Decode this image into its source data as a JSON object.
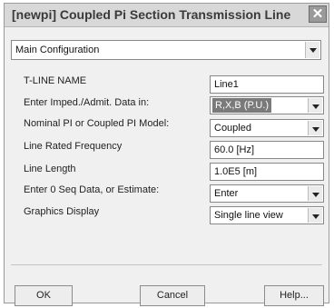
{
  "window": {
    "title": "[newpi] Coupled Pi Section Transmission Line",
    "close_glyph": "✕"
  },
  "configuration_select": {
    "value": "Main Configuration"
  },
  "fields": [
    {
      "label": "T-LINE NAME",
      "value": "Line1",
      "type": "text"
    },
    {
      "label": "Enter Imped./Admit. Data in:",
      "value": "R,X,B (P.U.)",
      "type": "select"
    },
    {
      "label": "Nominal PI or Coupled PI Model:",
      "value": "Coupled",
      "type": "select"
    },
    {
      "label": "Line Rated Frequency",
      "value": "60.0 [Hz]",
      "type": "text"
    },
    {
      "label": "Line Length",
      "value": "1.0E5 [m]",
      "type": "text"
    },
    {
      "label": "Enter 0 Seq Data, or Estimate:",
      "value": "Enter",
      "type": "select"
    },
    {
      "label": "Graphics Display",
      "value": "Single line view",
      "type": "select"
    }
  ],
  "buttons": {
    "ok": "OK",
    "cancel": "Cancel",
    "help": "Help..."
  }
}
